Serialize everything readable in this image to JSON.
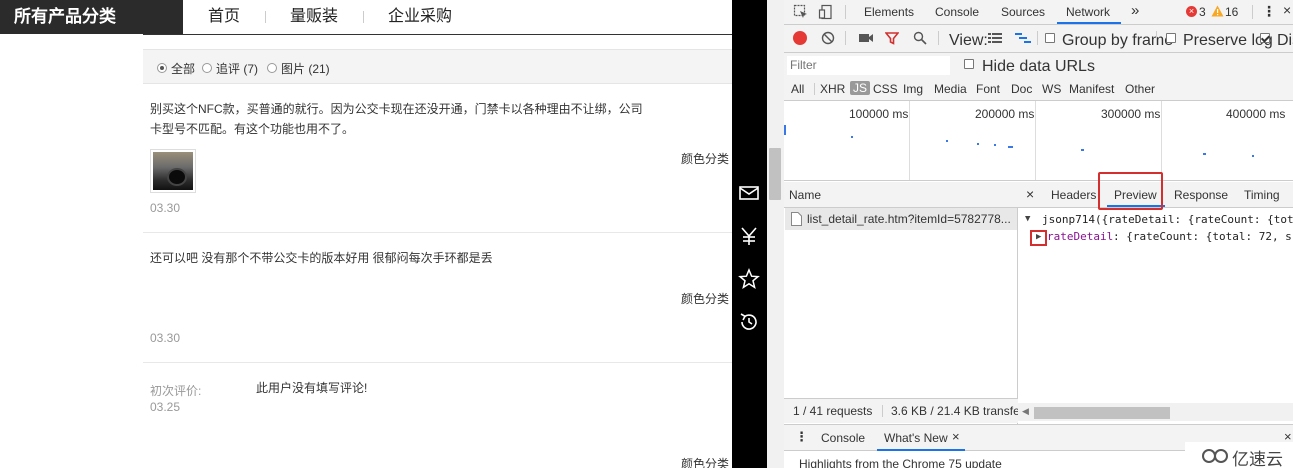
{
  "shop": {
    "category_label": "所有产品分类",
    "nav": [
      "首页",
      "量贩装",
      "企业采购"
    ],
    "filter": {
      "options": [
        {
          "label": "全部",
          "selected": true
        },
        {
          "label": "追评 (7)",
          "selected": false
        },
        {
          "label": "图片 (21)",
          "selected": false
        }
      ]
    },
    "reviews": [
      {
        "text_line1": "别买这个NFC款，买普通的就行。因为公交卡现在还没开通，门禁卡以各种理由不让绑，公司",
        "text_line2": "卡型号不匹配。有这个功能也用不了。",
        "meta": "颜色分类",
        "date": "03.30"
      },
      {
        "text_line1": "还可以吧 没有那个不带公交卡的版本好用 很郁闷每次手环都是丢",
        "meta": "颜色分类",
        "date": "03.30"
      },
      {
        "label": "初次评价:",
        "text_line1": "此用户没有填写评论!",
        "date": "03.25",
        "meta": "颜色分类"
      }
    ]
  },
  "toolbar_icons": [
    "mail-icon",
    "yen-icon",
    "star-icon",
    "history-icon"
  ],
  "devtools": {
    "tabs": [
      "Elements",
      "Console",
      "Sources",
      "Network"
    ],
    "active_tab": "Network",
    "more": "»",
    "errors": "3",
    "warnings": "16",
    "view_label": "View:",
    "group_by_frame": "Group by frame",
    "preserve_log": "Preserve log",
    "disable_cache": "Dis",
    "filter_placeholder": "Filter",
    "hide_data_urls": "Hide data URLs",
    "types": [
      "All",
      "XHR",
      "JS",
      "CSS",
      "Img",
      "Media",
      "Font",
      "Doc",
      "WS",
      "Manifest",
      "Other"
    ],
    "active_type": "JS",
    "timeline_labels": [
      "100000 ms",
      "200000 ms",
      "300000 ms",
      "400000 ms"
    ],
    "name_header": "Name",
    "request_name": "list_detail_rate.htm?itemId=5782778...",
    "detail_tabs": [
      "Headers",
      "Preview",
      "Response",
      "Timing"
    ],
    "active_detail_tab": "Preview",
    "json_line1": "jsonp714({rateDetail: {rateCount: {tot",
    "json_line2_key": "rateDetail",
    "json_line2_rest": ": {rateCount: {total: 72, s",
    "status_requests": "1 / 41 requests",
    "status_size": "3.6 KB / 21.4 KB transfe",
    "drawer_tabs": [
      "Console",
      "What's New"
    ],
    "drawer_text": "Highlights from the Chrome 75 update"
  },
  "watermark": "亿速云",
  "colors": {
    "highlight_red": "#d32f2f",
    "record_red": "#e53935",
    "accent_blue": "#1a73e8",
    "error_red": "#e53935",
    "warning_yellow": "#f9a825"
  }
}
